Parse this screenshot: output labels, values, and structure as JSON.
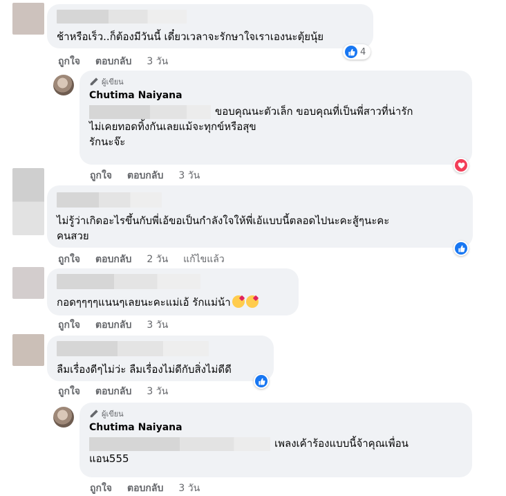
{
  "comments": [
    {
      "text": "ช้าหรือเร็ว..ก็ต้องมีวันนี้ เดี๋ยวเวลาจะรักษาใจเราเองนะตุ้ยนุ้ย",
      "actions": {
        "like": "ถูกใจ",
        "reply": "ตอบกลับ",
        "time": "3 วัน"
      },
      "reaction_count": "4"
    },
    {
      "author_badge": "ผู้เขียน",
      "author": "Chutima Naiyana",
      "line1": "ขอบคุณนะตัวเล็ก ขอบคุณที่เป็นพี่สาวที่น่ารัก",
      "line2": "ไม่เคยทอดทิ้งกันเลยแม้จะทุกข์หรือสุข",
      "line3": "รักนะจ๊ะ",
      "actions": {
        "like": "ถูกใจ",
        "reply": "ตอบกลับ",
        "time": "3 วัน"
      }
    },
    {
      "line1": "ไม่รู้ว่าเกิดอะไรขึ้นกับพี่เอ้ขอเป็นกำลังใจให้พี่เอ้แบบนี้ตลอดไปนะคะสู้ๆนะคะ",
      "line2": "คนสวย",
      "actions": {
        "like": "ถูกใจ",
        "reply": "ตอบกลับ",
        "time": "2 วัน",
        "edited": "แก้ไขแล้ว"
      }
    },
    {
      "text": "กอดๆๆๆๆแนนๆเลยนะคะแม่เอ้ รักแม่น้า",
      "actions": {
        "like": "ถูกใจ",
        "reply": "ตอบกลับ",
        "time": "3 วัน"
      }
    },
    {
      "text": "ลืมเรื่องดีๆไม่ว่ะ ลืมเรื่องไม่ดีกับสิ่งไม่ดีดี",
      "actions": {
        "like": "ถูกใจ",
        "reply": "ตอบกลับ",
        "time": "3 วัน"
      }
    },
    {
      "author_badge": "ผู้เขียน",
      "author": "Chutima Naiyana",
      "line1": "เพลงเค้าร้องแบบนี้จ้าคุณเพื่อน",
      "line2": "แอน555",
      "actions": {
        "like": "ถูกใจ",
        "reply": "ตอบกลับ",
        "time": "3 วัน"
      }
    }
  ],
  "colors": {
    "like_blue": "#1877f2",
    "love_red": "#f33e58",
    "bubble_bg": "#f0f2f5",
    "meta_gray": "#65676b"
  },
  "icons": {
    "badge": "pencil-icon",
    "like": "thumbs-up-icon",
    "love": "heart-icon",
    "emoji": "kissing-heart-emoji"
  }
}
